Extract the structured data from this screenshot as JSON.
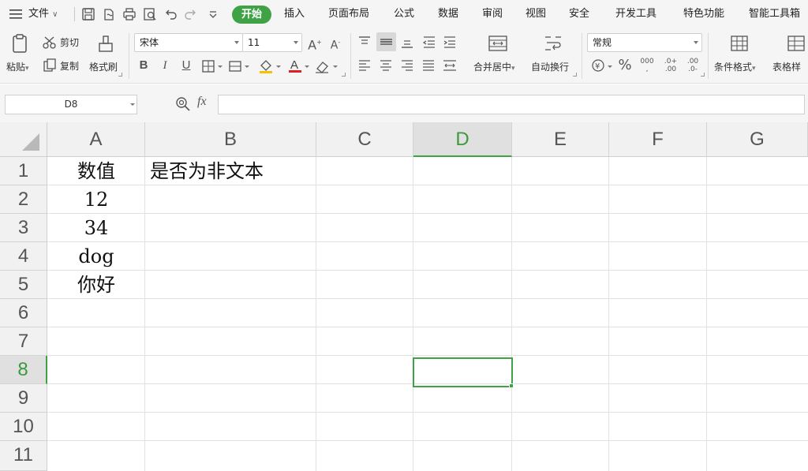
{
  "menubar": {
    "file_label": "文件",
    "tabs": [
      "开始",
      "插入",
      "页面布局",
      "公式",
      "数据",
      "审阅",
      "视图",
      "安全",
      "开发工具",
      "特色功能",
      "智能工具箱"
    ]
  },
  "ribbon": {
    "paste": "粘贴",
    "cut": "剪切",
    "copy": "复制",
    "format_painter": "格式刷",
    "font_name": "宋体",
    "font_size": "11",
    "merge_center": "合并居中",
    "wrap_text": "自动换行",
    "number_format": "常规",
    "conditional_format": "条件格式",
    "table_style": "表格样"
  },
  "formula_bar": {
    "name_box": "D8",
    "fx_label": "fx",
    "formula": ""
  },
  "grid": {
    "columns": [
      "A",
      "B",
      "C",
      "D",
      "E",
      "F",
      "G"
    ],
    "rows": [
      "1",
      "2",
      "3",
      "4",
      "5",
      "6",
      "7",
      "8",
      "9",
      "10",
      "11"
    ],
    "active_cell": "D8",
    "cells": {
      "A1": "数值",
      "B1": "是否为非文本",
      "A2": "12",
      "A3": "34",
      "A4": "dog",
      "A5": "你好"
    }
  },
  "colors": {
    "accent": "#3fa346",
    "header_bg": "#f1f1f1",
    "toolbar_bg": "#f5f5f5"
  }
}
